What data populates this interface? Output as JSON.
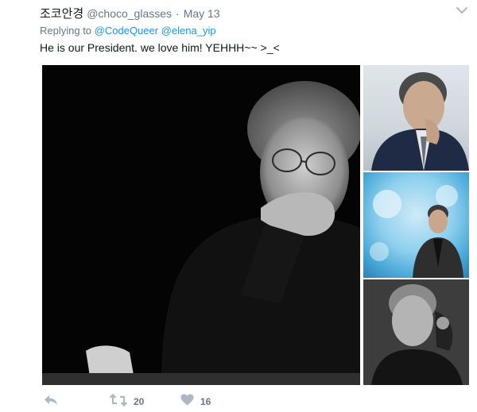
{
  "tweet": {
    "display_name": "조코안경",
    "handle": "@choco_glasses",
    "separator": "·",
    "date": "May 13",
    "replying_to_prefix": "Replying to",
    "mentions": [
      "@CodeQueer",
      "@elena_yip"
    ],
    "text": "He is our President. we love him! YEHHH~~ >_<",
    "retweet_count": "20",
    "like_count": "16"
  },
  "icons": {
    "caret": "chevron-down-icon",
    "reply": "reply-icon",
    "retweet": "retweet-icon",
    "like": "heart-icon"
  },
  "colors": {
    "text_primary": "#14171a",
    "text_secondary": "#657786",
    "link": "#1b95e0",
    "icon": "#aab8c2"
  }
}
